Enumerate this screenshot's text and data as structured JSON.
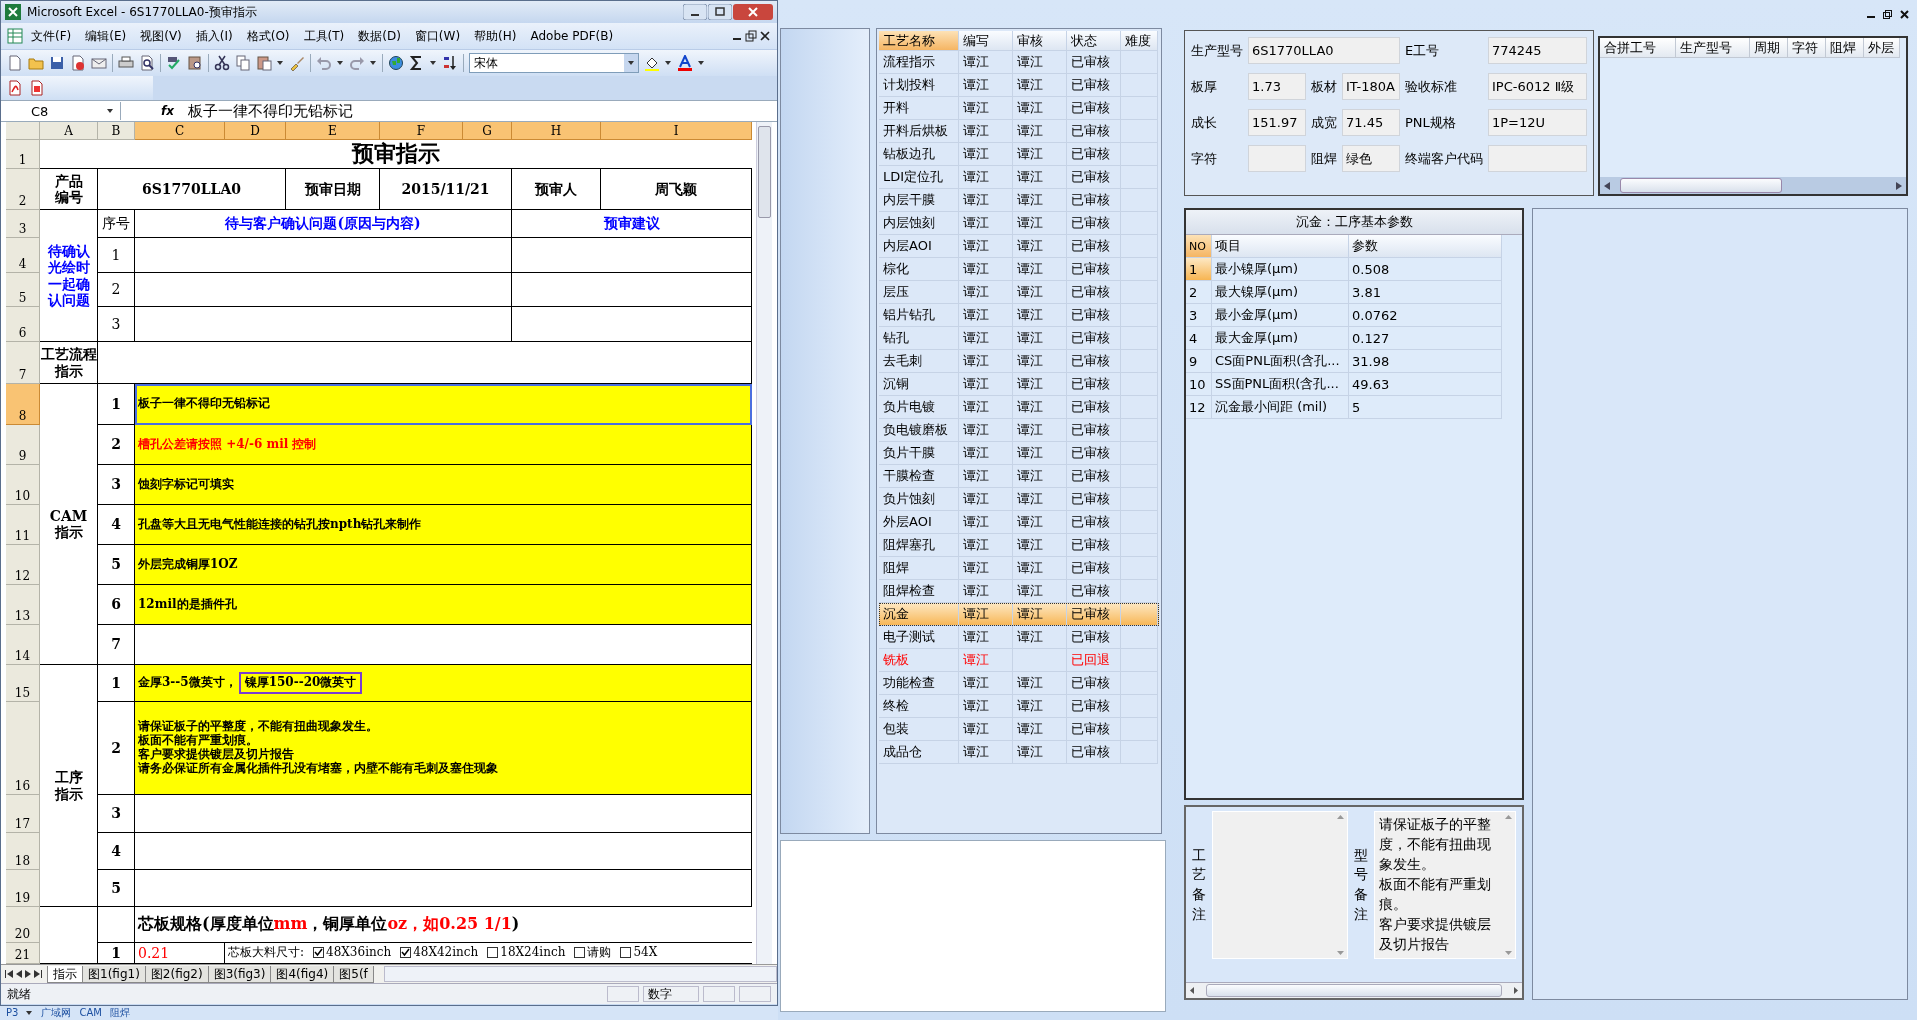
{
  "excel": {
    "title": "Microsoft Excel - 6S1770LLA0-预审指示",
    "menu": [
      "文件(F)",
      "编辑(E)",
      "视图(V)",
      "插入(I)",
      "格式(O)",
      "工具(T)",
      "数据(D)",
      "窗口(W)",
      "帮助(H)",
      "Adobe PDF(B)"
    ],
    "font_name": "宋体",
    "name_box": "C8",
    "fx_label": "fx",
    "formula": "板子一律不得印无铅标记",
    "columns": [
      {
        "label": "A",
        "selected": false
      },
      {
        "label": "B",
        "selected": false
      },
      {
        "label": "C",
        "selected": true
      },
      {
        "label": "D",
        "selected": true
      },
      {
        "label": "E",
        "selected": true
      },
      {
        "label": "F",
        "selected": true
      },
      {
        "label": "G",
        "selected": true
      },
      {
        "label": "H",
        "selected": true
      },
      {
        "label": "I",
        "selected": true
      }
    ],
    "rows": [
      {
        "label": "1",
        "selected": false
      },
      {
        "label": "2",
        "selected": false
      },
      {
        "label": "3",
        "selected": false
      },
      {
        "label": "4",
        "selected": false
      },
      {
        "label": "5",
        "selected": false
      },
      {
        "label": "6",
        "selected": false
      },
      {
        "label": "7",
        "selected": false
      },
      {
        "label": "8",
        "selected": true
      },
      {
        "label": "9",
        "selected": false
      },
      {
        "label": "10",
        "selected": false
      },
      {
        "label": "11",
        "selected": false
      },
      {
        "label": "12",
        "selected": false
      },
      {
        "label": "13",
        "selected": false
      },
      {
        "label": "14",
        "selected": false
      },
      {
        "label": "15",
        "selected": false
      },
      {
        "label": "16",
        "selected": false
      },
      {
        "label": "17",
        "selected": false
      },
      {
        "label": "18",
        "selected": false
      },
      {
        "label": "19",
        "selected": false
      },
      {
        "label": "20",
        "selected": false
      },
      {
        "label": "21",
        "selected": false
      }
    ],
    "sheet": {
      "title": "预审指示",
      "product_label": "产品编号",
      "product": "6S1770LLA0",
      "date_label": "预审日期",
      "date": "2015/11/21",
      "reviewer_label": "预审人",
      "reviewer": "周飞颖",
      "confirm_label": "待确认光绘时一起确认问题",
      "no_header": "序号",
      "question_header": "待与客户确认问题(原因与内容)",
      "advice_header": "预审建议",
      "confirm_rows": [
        "1",
        "2",
        "3"
      ],
      "flow_label": "工艺流程指示",
      "cam_label": "CAM指示",
      "cam_rows": [
        {
          "no": "1",
          "text": "板子一律不得印无铅标记",
          "highlight": true,
          "red": false,
          "selected": true
        },
        {
          "no": "2",
          "text": "槽孔公差请按照 +4/-6 mil 控制",
          "highlight": true,
          "red": true,
          "selected": false
        },
        {
          "no": "3",
          "text": "蚀刻字标记可填实",
          "highlight": true,
          "red": false,
          "selected": false
        },
        {
          "no": "4",
          "text": "孔盘等大且无电气性能连接的钻孔按npth钻孔来制作",
          "highlight": true,
          "red": false,
          "selected": false
        },
        {
          "no": "5",
          "text": "外层完成铜厚1OZ",
          "highlight": true,
          "red": false,
          "selected": false
        },
        {
          "no": "6",
          "text": "12mil的是插件孔",
          "highlight": true,
          "red": false,
          "selected": false
        },
        {
          "no": "7",
          "highlight": false,
          "selected": false
        }
      ],
      "process_label": "工序指示",
      "process_rows": [
        {
          "no": "1",
          "text": "金厚3--5微英寸，",
          "boxed": "镍厚150--20微英寸",
          "highlight": true,
          "selected": false
        },
        {
          "no": "2",
          "lines": [
            "请保证板子的平整度，不能有扭曲现象发生。",
            "板面不能有严重划痕。",
            "客户要求提供镀层及切片报告",
            "请务必保证所有金属化插件孔没有堵塞，内壁不能有毛刺及塞住现象"
          ],
          "highlight": true,
          "selected": false
        },
        {
          "no": "3",
          "highlight": false,
          "selected": false
        },
        {
          "no": "4",
          "highlight": false,
          "selected": false
        },
        {
          "no": "5",
          "highlight": false,
          "selected": false
        }
      ],
      "core_title": [
        {
          "text": "芯板规格(厚度单位",
          "red": false
        },
        {
          "text": "mm",
          "red": true
        },
        {
          "text": "，铜厚单位",
          "red": false
        },
        {
          "text": "oz，如0.25 1/1",
          "red": true
        },
        {
          "text": ")",
          "red": false
        }
      ],
      "core_no": "1",
      "core_value": "0.21",
      "core_size_label": "芯板大料尺寸:",
      "core_options": [
        {
          "label": "48X36inch",
          "checked": true
        },
        {
          "label": "48X42inch",
          "checked": true
        },
        {
          "label": "18X24inch",
          "checked": false
        },
        {
          "label": "请购",
          "checked": false
        },
        {
          "label": "54X",
          "checked": false
        }
      ]
    },
    "sheet_tabs": [
      {
        "label": "指示",
        "selected": true
      },
      {
        "label": "图1(fig1)",
        "selected": false
      },
      {
        "label": "图2(fig2)",
        "selected": false
      },
      {
        "label": "图3(fig3)",
        "selected": false
      },
      {
        "label": "图4(fig4)",
        "selected": false
      },
      {
        "label": "图5(f",
        "selected": false
      }
    ],
    "status": "就绪",
    "status_mode": "数字"
  },
  "bottom_tabs": [
    "P3",
    "广域网",
    "CAM",
    "阻焊"
  ],
  "steps": {
    "columns": [
      "工艺名称",
      "编写",
      "审核",
      "状态",
      "难度"
    ],
    "rows": [
      {
        "name": "流程指示",
        "writer": "谭江",
        "reviewer": "谭江",
        "status": "已审核",
        "returned": false,
        "selected": false
      },
      {
        "name": "计划投料",
        "writer": "谭江",
        "reviewer": "谭江",
        "status": "已审核",
        "returned": false,
        "selected": false
      },
      {
        "name": "开料",
        "writer": "谭江",
        "reviewer": "谭江",
        "status": "已审核",
        "returned": false,
        "selected": false
      },
      {
        "name": "开料后烘板",
        "writer": "谭江",
        "reviewer": "谭江",
        "status": "已审核",
        "returned": false,
        "selected": false
      },
      {
        "name": "钻板边孔",
        "writer": "谭江",
        "reviewer": "谭江",
        "status": "已审核",
        "returned": false,
        "selected": false
      },
      {
        "name": "LDI定位孔",
        "writer": "谭江",
        "reviewer": "谭江",
        "status": "已审核",
        "returned": false,
        "selected": false
      },
      {
        "name": "内层干膜",
        "writer": "谭江",
        "reviewer": "谭江",
        "status": "已审核",
        "returned": false,
        "selected": false
      },
      {
        "name": "内层蚀刻",
        "writer": "谭江",
        "reviewer": "谭江",
        "status": "已审核",
        "returned": false,
        "selected": false
      },
      {
        "name": "内层AOI",
        "writer": "谭江",
        "reviewer": "谭江",
        "status": "已审核",
        "returned": false,
        "selected": false
      },
      {
        "name": "棕化",
        "writer": "谭江",
        "reviewer": "谭江",
        "status": "已审核",
        "returned": false,
        "selected": false
      },
      {
        "name": "层压",
        "writer": "谭江",
        "reviewer": "谭江",
        "status": "已审核",
        "returned": false,
        "selected": false
      },
      {
        "name": "铝片钻孔",
        "writer": "谭江",
        "reviewer": "谭江",
        "status": "已审核",
        "returned": false,
        "selected": false
      },
      {
        "name": "钻孔",
        "writer": "谭江",
        "reviewer": "谭江",
        "status": "已审核",
        "returned": false,
        "selected": false
      },
      {
        "name": "去毛刺",
        "writer": "谭江",
        "reviewer": "谭江",
        "status": "已审核",
        "returned": false,
        "selected": false
      },
      {
        "name": "沉铜",
        "writer": "谭江",
        "reviewer": "谭江",
        "status": "已审核",
        "returned": false,
        "selected": false
      },
      {
        "name": "负片电镀",
        "writer": "谭江",
        "reviewer": "谭江",
        "status": "已审核",
        "returned": false,
        "selected": false
      },
      {
        "name": "负电镀磨板",
        "writer": "谭江",
        "reviewer": "谭江",
        "status": "已审核",
        "returned": false,
        "selected": false
      },
      {
        "name": "负片干膜",
        "writer": "谭江",
        "reviewer": "谭江",
        "status": "已审核",
        "returned": false,
        "selected": false
      },
      {
        "name": "干膜检查",
        "writer": "谭江",
        "reviewer": "谭江",
        "status": "已审核",
        "returned": false,
        "selected": false
      },
      {
        "name": "负片蚀刻",
        "writer": "谭江",
        "reviewer": "谭江",
        "status": "已审核",
        "returned": false,
        "selected": false
      },
      {
        "name": "外层AOI",
        "writer": "谭江",
        "reviewer": "谭江",
        "status": "已审核",
        "returned": false,
        "selected": false
      },
      {
        "name": "阻焊塞孔",
        "writer": "谭江",
        "reviewer": "谭江",
        "status": "已审核",
        "returned": false,
        "selected": false
      },
      {
        "name": "阻焊",
        "writer": "谭江",
        "reviewer": "谭江",
        "status": "已审核",
        "returned": false,
        "selected": false
      },
      {
        "name": "阻焊检查",
        "writer": "谭江",
        "reviewer": "谭江",
        "status": "已审核",
        "returned": false,
        "selected": false
      },
      {
        "name": "沉金",
        "writer": "谭江",
        "reviewer": "谭江",
        "status": "已审核",
        "returned": false,
        "selected": true
      },
      {
        "name": "电子测试",
        "writer": "谭江",
        "reviewer": "谭江",
        "status": "已审核",
        "returned": false,
        "selected": false
      },
      {
        "name": "铣板",
        "writer": "谭江",
        "status": "已回退",
        "returned": true,
        "selected": false
      },
      {
        "name": "功能检查",
        "writer": "谭江",
        "reviewer": "谭江",
        "status": "已审核",
        "returned": false,
        "selected": false
      },
      {
        "name": "终检",
        "writer": "谭江",
        "reviewer": "谭江",
        "status": "已审核",
        "returned": false,
        "selected": false
      },
      {
        "name": "包装",
        "writer": "谭江",
        "reviewer": "谭江",
        "status": "已审核",
        "returned": false,
        "selected": false
      },
      {
        "name": "成品仓",
        "writer": "谭江",
        "reviewer": "谭江",
        "status": "已审核",
        "returned": false,
        "selected": false
      }
    ]
  },
  "info": {
    "fields": [
      {
        "label": "生产型号",
        "value": "6S1770LLA0",
        "wide": true
      },
      {
        "label": "E工号",
        "value": "774245",
        "wide": false
      },
      {
        "label": "板厚",
        "value": "1.73",
        "wide": false
      },
      {
        "label": "板材",
        "value": "IT-180A",
        "wide": false
      },
      {
        "label": "验收标准",
        "value": "IPC-6012 Ⅱ级",
        "wide": false
      },
      {
        "label": "成长",
        "value": "151.97",
        "wide": false
      },
      {
        "label": "成宽",
        "value": "71.45",
        "wide": false
      },
      {
        "label": "PNL规格",
        "value": "1P=12U",
        "wide": false
      },
      {
        "label": "字符",
        "wide": false
      },
      {
        "label": "阻焊",
        "value": "绿色",
        "wide": false
      },
      {
        "label": "终端客户代码",
        "wide": false
      }
    ]
  },
  "merge_grid": {
    "columns": [
      "合拼工号",
      "生产型号",
      "周期",
      "字符",
      "阻焊",
      "外层"
    ]
  },
  "params": {
    "title": "沉金：工序基本参数",
    "columns": [
      "NO",
      "项目",
      "参数"
    ],
    "rows": [
      {
        "no": "1",
        "item": "最小镍厚(μm)",
        "value": "0.508",
        "selected": true
      },
      {
        "no": "2",
        "item": "最大镍厚(μm)",
        "value": "3.81",
        "selected": false
      },
      {
        "no": "3",
        "item": "最小金厚(μm)",
        "value": "0.0762",
        "selected": false
      },
      {
        "no": "4",
        "item": "最大金厚(μm)",
        "value": "0.127",
        "selected": false
      },
      {
        "no": "9",
        "item": "CS面PNL面积(含孔...",
        "value": "31.98",
        "selected": false
      },
      {
        "no": "10",
        "item": "SS面PNL面积(含孔...",
        "value": "49.63",
        "selected": false
      },
      {
        "no": "12",
        "item": "沉金最小间距 (mil)",
        "value": "5",
        "selected": false
      }
    ]
  },
  "remarks": {
    "process_label": "工艺备注",
    "model_label": "型号备注",
    "model_lines": [
      "请保证板子的平整度，不能有扭曲现象发生。",
      "板面不能有严重划痕。",
      "客户要求提供镀层及切片报告"
    ]
  }
}
